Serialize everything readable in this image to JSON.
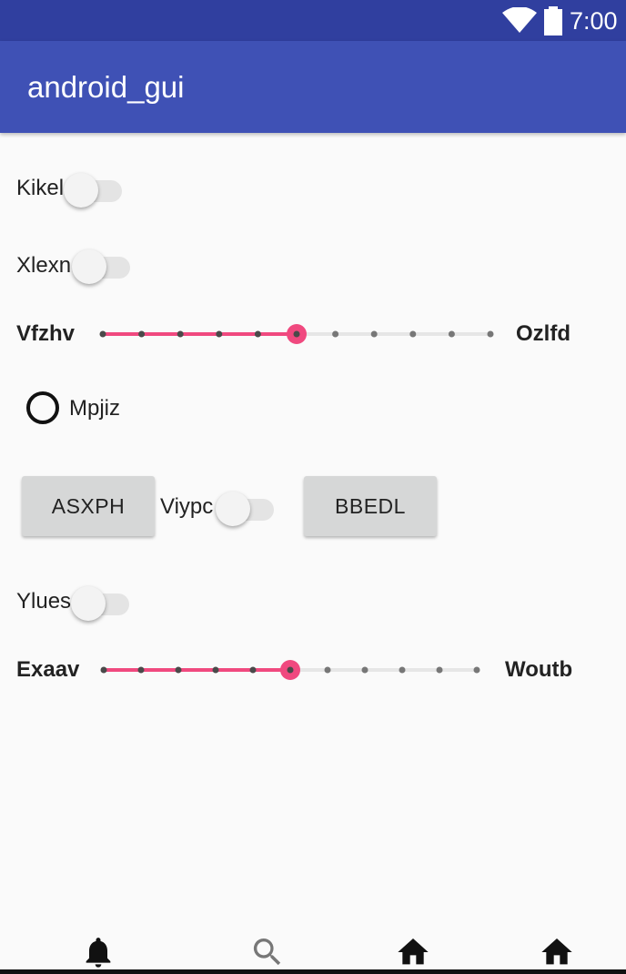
{
  "status_bar": {
    "time": "7:00",
    "icons": [
      "wifi-icon",
      "battery-icon"
    ]
  },
  "app_bar": {
    "title": "android_gui"
  },
  "switches": [
    {
      "label": "Kikel",
      "checked": false
    },
    {
      "label": "Xlexn",
      "checked": false
    },
    {
      "label": "Viypc",
      "checked": false
    },
    {
      "label": "Ylues",
      "checked": false
    }
  ],
  "sliders": [
    {
      "left_label": "Vfzhv",
      "right_label": "Ozlfd",
      "steps": 10,
      "value": 5
    },
    {
      "left_label": "Exaav",
      "right_label": "Woutb",
      "steps": 10,
      "value": 5
    }
  ],
  "radio": {
    "label": "Mpjiz",
    "checked": false
  },
  "buttons": {
    "asxph": "ASXPH",
    "bbedl": "BBEDL"
  },
  "bottom_nav": {
    "icons": [
      "bell-icon",
      "search-icon",
      "home-icon",
      "home-icon"
    ]
  },
  "colors": {
    "status_bar": "#303f9f",
    "app_bar": "#3f51b5",
    "accent": "#f0497f",
    "background": "#fafafa"
  }
}
